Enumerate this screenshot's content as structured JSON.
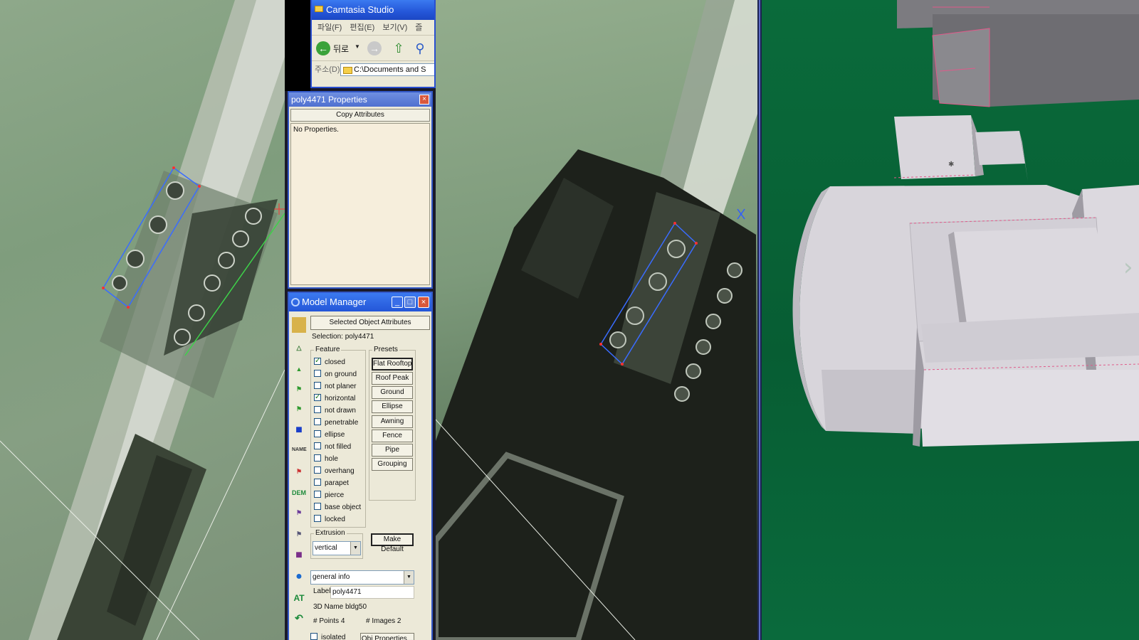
{
  "explorer": {
    "title": "Camtasia Studio",
    "menu": [
      "파일(F)",
      "편집(E)",
      "보기(V)",
      "즐"
    ],
    "back_label": "뒤로",
    "address_label": "주소(D)",
    "address_value": "C:\\Documents and S"
  },
  "properties": {
    "title": "poly4471 Properties",
    "close_glyph": "×",
    "copy_button": "Copy Attributes",
    "body_text": "No Properties."
  },
  "model_manager": {
    "title": "Model Manager",
    "selected_attr_button": "Selected Object Attributes",
    "selection": "Selection: poly4471",
    "feature_caption": "Feature",
    "features": [
      {
        "label": "closed",
        "checked": true
      },
      {
        "label": "on ground",
        "checked": false
      },
      {
        "label": "not planer",
        "checked": false
      },
      {
        "label": "horizontal",
        "checked": true
      },
      {
        "label": "not drawn",
        "checked": false
      },
      {
        "label": "penetrable",
        "checked": false
      },
      {
        "label": "ellipse",
        "checked": false
      },
      {
        "label": "not filled",
        "checked": false
      },
      {
        "label": "hole",
        "checked": false
      },
      {
        "label": "overhang",
        "checked": false
      },
      {
        "label": "parapet",
        "checked": false
      },
      {
        "label": "pierce",
        "checked": false
      },
      {
        "label": "base object",
        "checked": false
      },
      {
        "label": "locked",
        "checked": false
      }
    ],
    "presets_caption": "Presets",
    "presets": [
      "Flat Rooftop",
      "Roof Peak",
      "Ground",
      "Ellipse",
      "Awning",
      "Fence",
      "Pipe",
      "Grouping"
    ],
    "make_default": "Make Default",
    "extrusion_caption": "Extrusion",
    "extrusion_value": "vertical",
    "info_select": "general info",
    "label_caption": "Label",
    "label_value": "poly4471",
    "name_3d": "3D Name bldg50",
    "points": "# Points 4",
    "images": "# Images 2",
    "isolated": "isolated",
    "obj_props_button": "Obj Properties..."
  },
  "tool_icons": [
    "folder-open-icon",
    "select-tool-icon",
    "poly-tool-icon",
    "flag-green-icon",
    "flag-tool-icon",
    "building-blue-icon",
    "name-tool-icon",
    "flag-red-icon",
    "dem-icon",
    "flag-purple-icon",
    "flag-gray-icon",
    "building-purple-icon",
    "globe-icon",
    "at-icon",
    "undo-icon"
  ],
  "tool_labels": {
    "name": "NAME",
    "dem": "DEM",
    "at": "AT"
  },
  "colors": {
    "xp_title_blue": "#2456d8",
    "panel_bg": "#ece9d8",
    "viewport_green": "#0a6b3b",
    "building_gray": "#d8d4da",
    "selection_outline": "#3a6cff"
  }
}
